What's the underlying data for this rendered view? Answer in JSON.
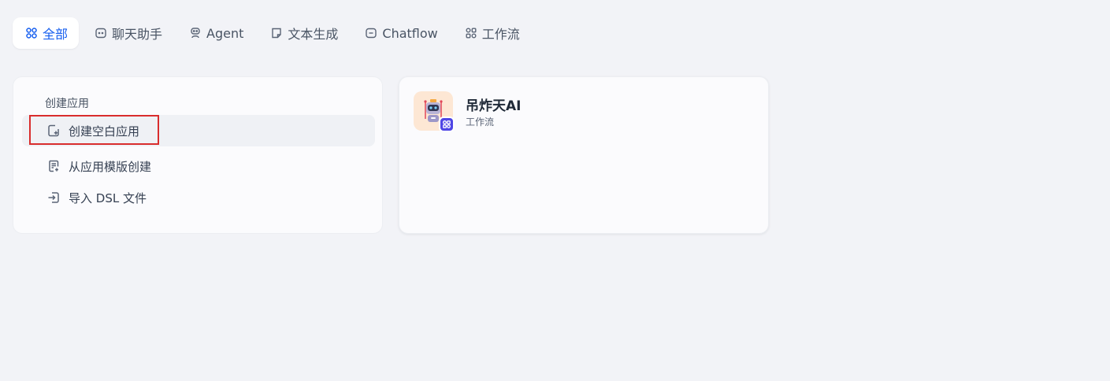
{
  "tabs": [
    {
      "label": "全部",
      "icon": "grid-icon",
      "active": true
    },
    {
      "label": "聊天助手",
      "icon": "chat-bubble-icon",
      "active": false
    },
    {
      "label": "Agent",
      "icon": "robot-icon",
      "active": false
    },
    {
      "label": "文本生成",
      "icon": "note-icon",
      "active": false
    },
    {
      "label": "Chatflow",
      "icon": "chatflow-icon",
      "active": false
    },
    {
      "label": "工作流",
      "icon": "workflow-icon",
      "active": false
    }
  ],
  "create": {
    "title": "创建应用",
    "options": [
      {
        "label": "创建空白应用",
        "icon": "file-plus-icon"
      },
      {
        "label": "从应用模版创建",
        "icon": "template-icon"
      },
      {
        "label": "导入 DSL 文件",
        "icon": "import-icon"
      }
    ]
  },
  "apps": [
    {
      "name": "吊炸天AI",
      "type": "工作流",
      "icon": "robot-avatar-icon",
      "badge_icon": "workflow-badge-icon"
    }
  ],
  "colors": {
    "accent": "#155eef",
    "background": "#f2f3f7",
    "highlight": "#d92d2d",
    "badge": "#4f46e5"
  }
}
